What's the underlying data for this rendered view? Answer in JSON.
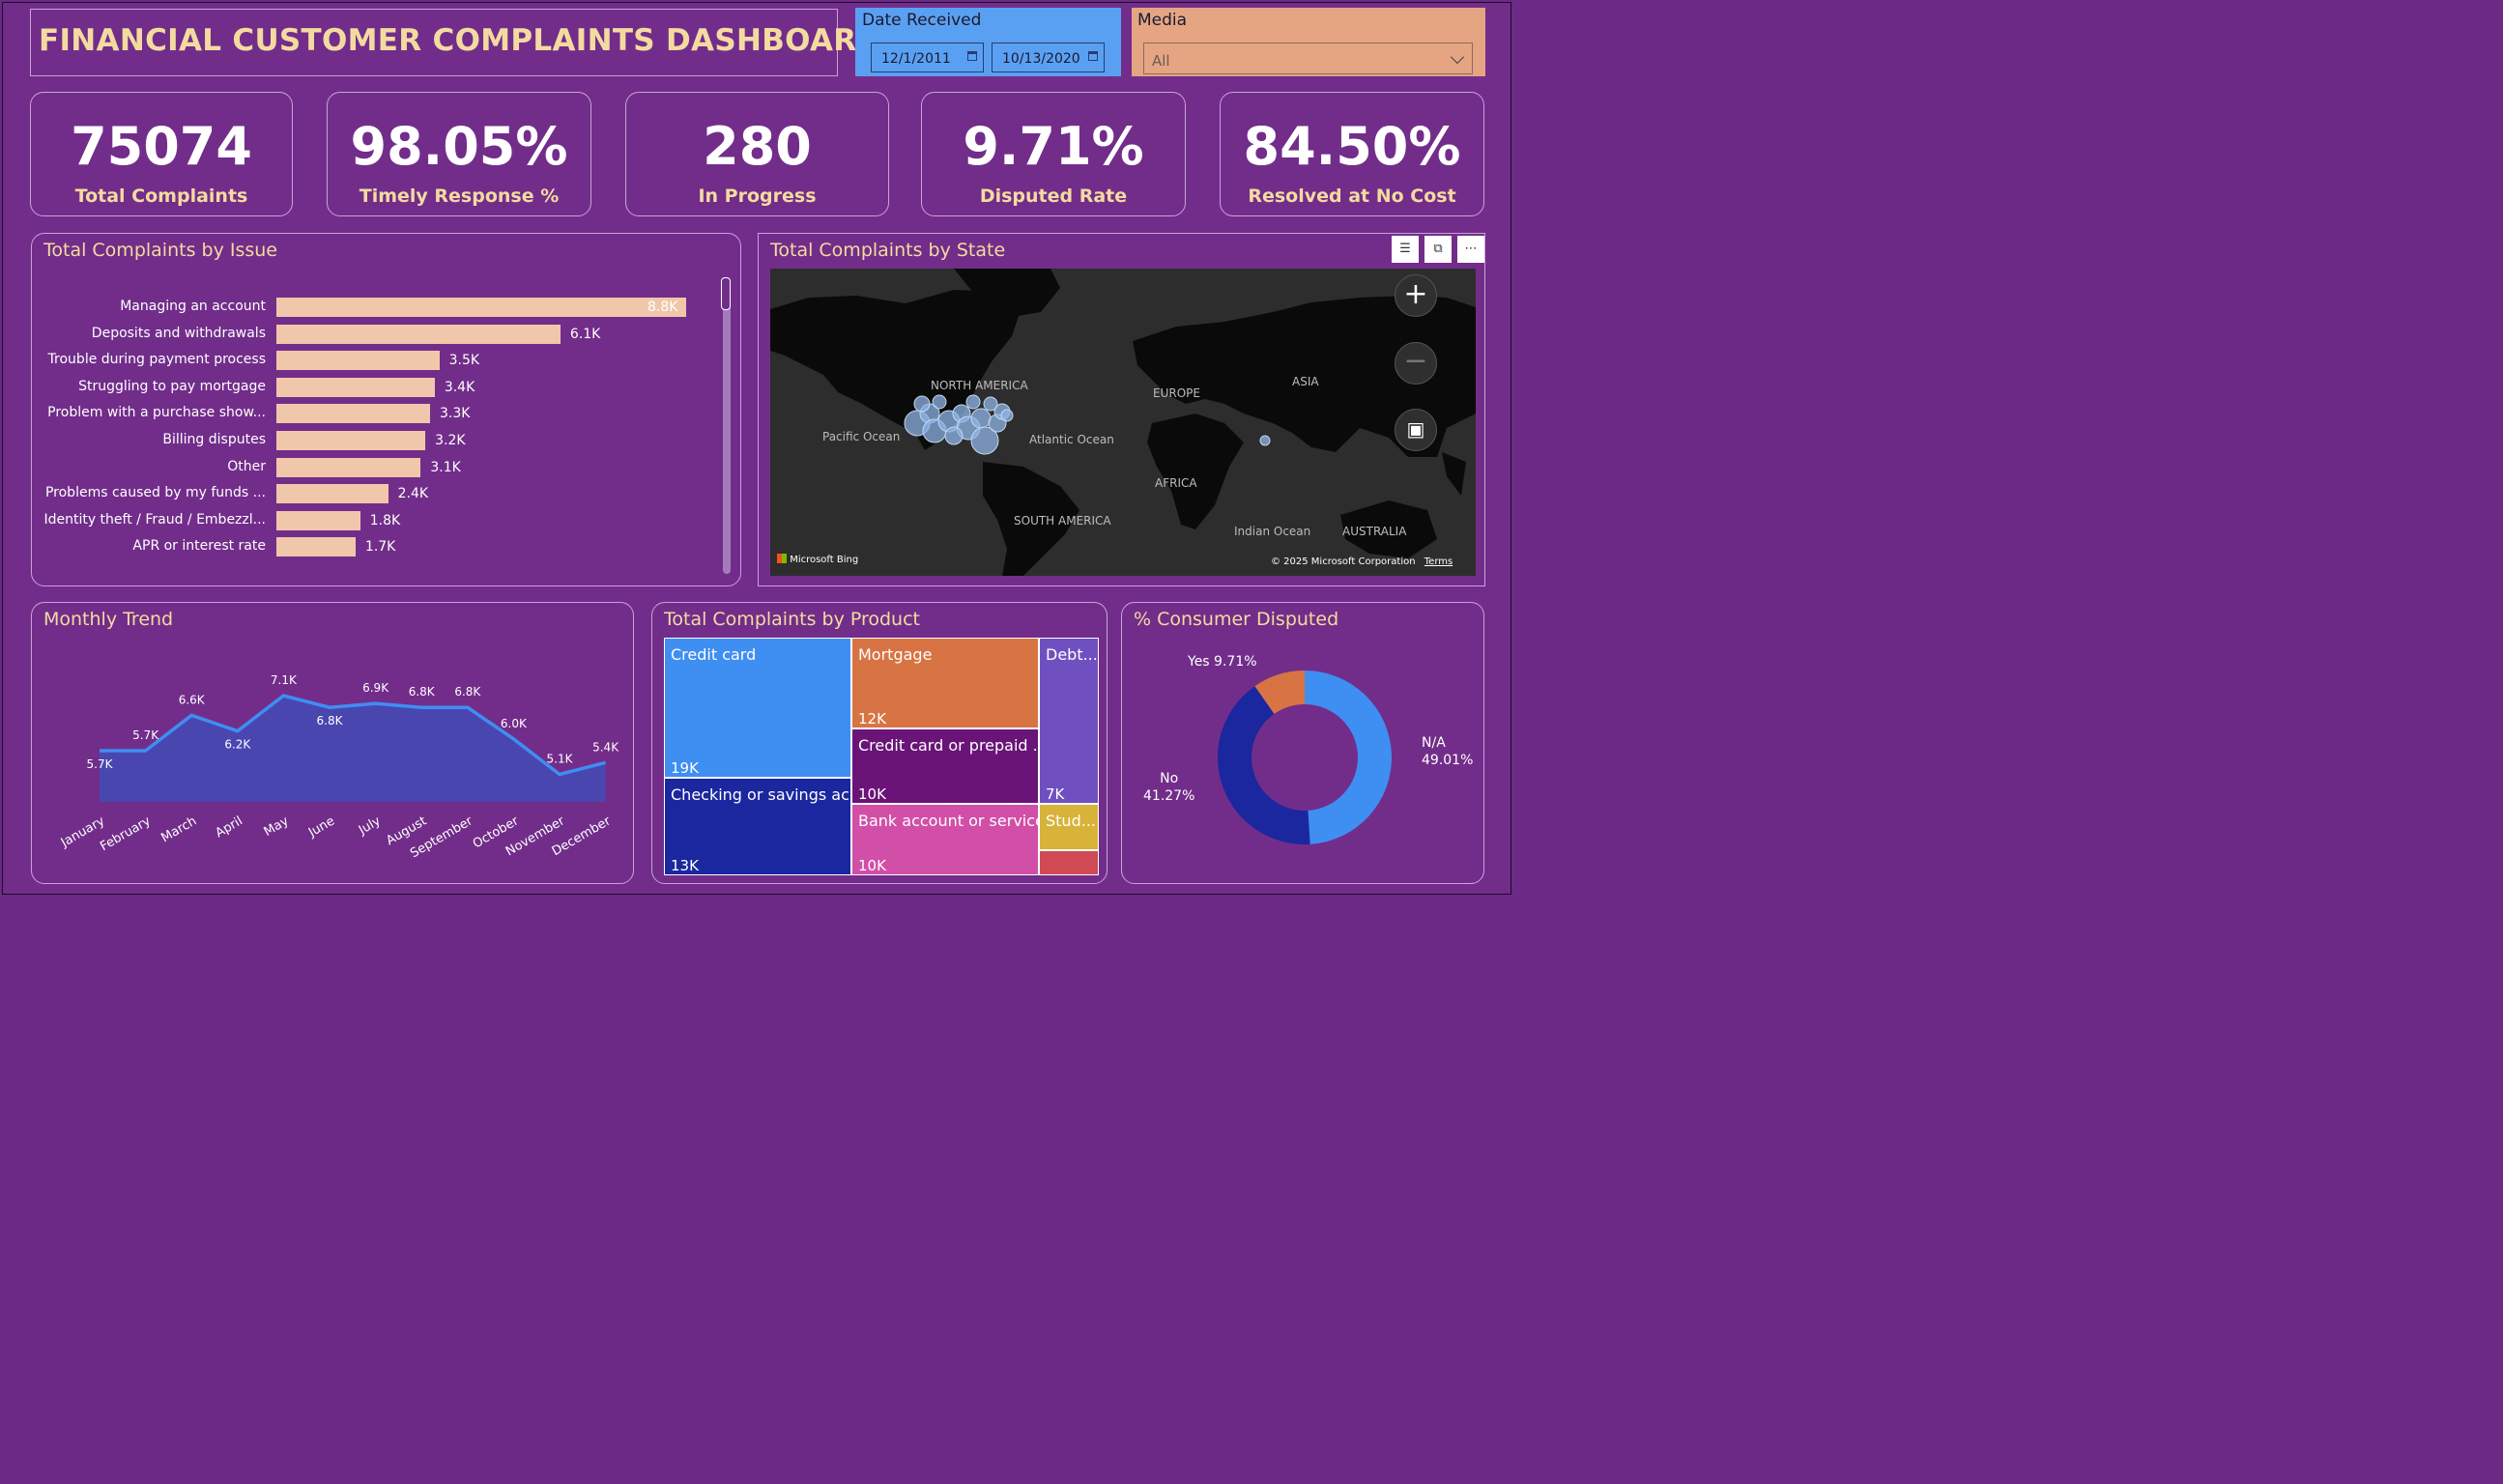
{
  "title": "FINANCIAL CUSTOMER COMPLAINTS DASHBOARD",
  "date_slicer": {
    "label": "Date Received",
    "start": "12/1/2011",
    "end": "10/13/2020"
  },
  "media_slicer": {
    "label": "Media",
    "selected": "All"
  },
  "kpis": [
    {
      "value": "75074",
      "caption": "Total Complaints"
    },
    {
      "value": "98.05%",
      "caption": "Timely Response %"
    },
    {
      "value": "280",
      "caption": "In Progress"
    },
    {
      "value": "9.71%",
      "caption": "Disputed Rate"
    },
    {
      "value": "84.50%",
      "caption": "Resolved at No Cost"
    }
  ],
  "issue_chart": {
    "title": "Total Complaints by Issue",
    "chart_data": {
      "type": "bar",
      "categories": [
        "Managing an account",
        "Deposits and withdrawals",
        "Trouble during payment process",
        "Struggling to pay mortgage",
        "Problem with a purchase show...",
        "Billing disputes",
        "Other",
        "Problems caused by my funds ...",
        "Identity theft / Fraud / Embezzl...",
        "APR or interest rate"
      ],
      "values": [
        8.8,
        6.1,
        3.5,
        3.4,
        3.3,
        3.2,
        3.1,
        2.4,
        1.8,
        1.7
      ],
      "labels": [
        "8.8K",
        "6.1K",
        "3.5K",
        "3.4K",
        "3.3K",
        "3.2K",
        "3.1K",
        "2.4K",
        "1.8K",
        "1.7K"
      ],
      "unit": "K"
    }
  },
  "map": {
    "title": "Total Complaints by State",
    "labels": {
      "north_america": "NORTH AMERICA",
      "europe": "EUROPE",
      "asia": "ASIA",
      "pacific": "Pacific Ocean",
      "atlantic": "Atlantic Ocean",
      "africa": "AFRICA",
      "south_america": "SOUTH AMERICA",
      "indian": "Indian Ocean",
      "australia": "AUSTRALIA"
    },
    "attribution": "Microsoft Bing",
    "copyright": "© 2025 Microsoft Corporation",
    "terms": "Terms"
  },
  "monthly_trend": {
    "title": "Monthly Trend",
    "chart_data": {
      "type": "area",
      "categories": [
        "January",
        "February",
        "March",
        "April",
        "May",
        "June",
        "July",
        "August",
        "September",
        "October",
        "November",
        "December"
      ],
      "values": [
        5.7,
        5.7,
        6.6,
        6.2,
        7.1,
        6.8,
        6.9,
        6.8,
        6.8,
        6.0,
        5.1,
        5.4
      ],
      "labels": [
        "5.7K",
        "5.7K",
        "6.6K",
        "6.2K",
        "7.1K",
        "6.8K",
        "6.9K",
        "6.8K",
        "6.8K",
        "6.0K",
        "5.1K",
        "5.4K"
      ],
      "unit": "K"
    }
  },
  "product_chart": {
    "title": "Total Complaints by Product",
    "tiles": [
      {
        "name": "Credit card",
        "value": "19K",
        "color": "#3f8ef2"
      },
      {
        "name": "Checking or savings ac...",
        "value": "13K",
        "color": "#1a279e"
      },
      {
        "name": "Mortgage",
        "value": "12K",
        "color": "#d87443"
      },
      {
        "name": "Credit card or prepaid ...",
        "value": "10K",
        "color": "#6a1478"
      },
      {
        "name": "Bank account or service",
        "value": "10K",
        "color": "#d24fa8"
      },
      {
        "name": "Debt...",
        "value": "7K",
        "color": "#7050c0"
      },
      {
        "name": "Stud...",
        "value": "",
        "color": "#d7b33a"
      },
      {
        "name": "",
        "value": "",
        "color": "#cf4a55"
      }
    ]
  },
  "disputed_chart": {
    "title": "% Consumer Disputed",
    "chart_data": {
      "type": "pie",
      "categories": [
        "N/A",
        "No",
        "Yes"
      ],
      "values": [
        49.01,
        41.27,
        9.71
      ],
      "colors": [
        "#3f8ef2",
        "#1a279e",
        "#d87443"
      ]
    },
    "labels": {
      "yes": "Yes 9.71%",
      "na_name": "N/A",
      "na_pct": "49.01%",
      "no_name": "No",
      "no_pct": "41.27%"
    }
  }
}
